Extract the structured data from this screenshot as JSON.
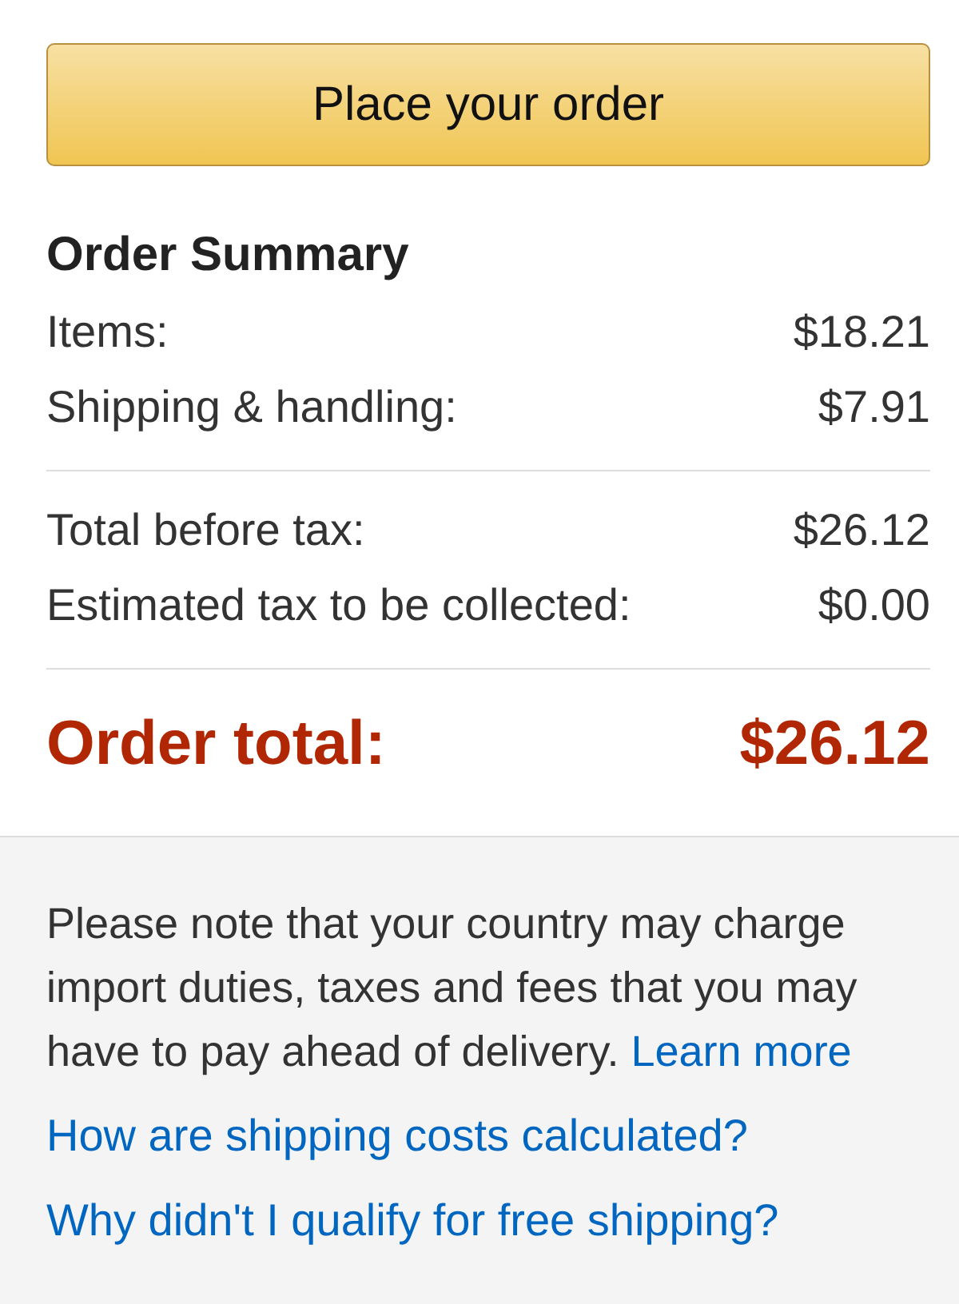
{
  "primary_button": {
    "label": "Place your order"
  },
  "order_summary": {
    "title": "Order Summary",
    "groups": [
      [
        {
          "label": "Items:",
          "value": "$18.21"
        },
        {
          "label": "Shipping & handling:",
          "value": "$7.91"
        }
      ],
      [
        {
          "label": "Total before tax:",
          "value": "$26.12"
        },
        {
          "label": "Estimated tax to be collected:",
          "value": "$0.00"
        }
      ]
    ],
    "total": {
      "label": "Order total:",
      "value": "$26.12"
    }
  },
  "notice": {
    "text": "Please note that your country may charge import duties, taxes and fees that you may have to pay ahead of delivery.",
    "link": "Learn more"
  },
  "help_links": [
    "How are shipping costs calculated?",
    "Why didn't I qualify for free shipping?"
  ]
}
